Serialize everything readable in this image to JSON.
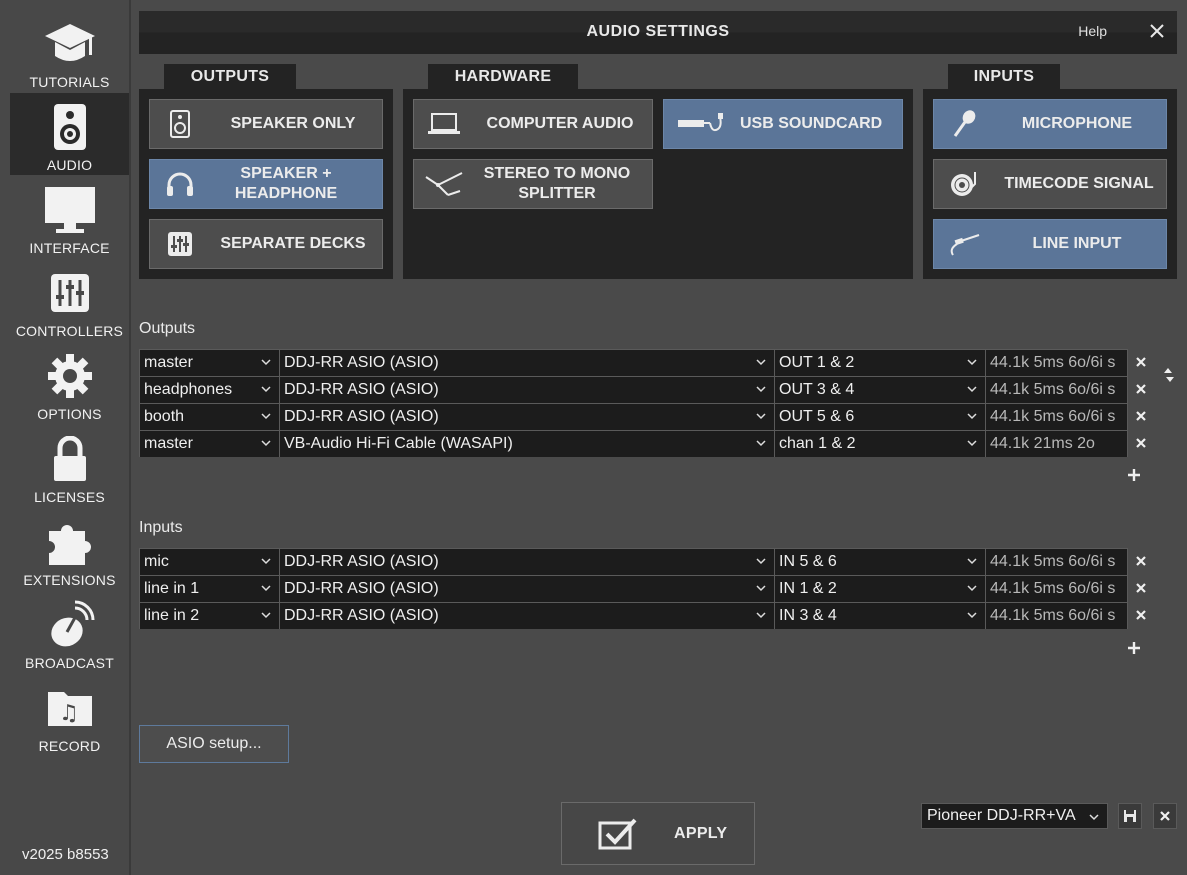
{
  "sidebar": {
    "items": [
      {
        "label": "TUTORIALS",
        "icon": "graduation-cap-icon"
      },
      {
        "label": "AUDIO",
        "icon": "speaker-icon",
        "active": true
      },
      {
        "label": "INTERFACE",
        "icon": "monitor-icon"
      },
      {
        "label": "CONTROLLERS",
        "icon": "sliders-icon"
      },
      {
        "label": "OPTIONS",
        "icon": "gear-icon"
      },
      {
        "label": "LICENSES",
        "icon": "lock-icon"
      },
      {
        "label": "EXTENSIONS",
        "icon": "puzzle-icon"
      },
      {
        "label": "BROADCAST",
        "icon": "satellite-dish-icon"
      },
      {
        "label": "RECORD",
        "icon": "music-folder-icon"
      }
    ],
    "version": "v2025 b8553"
  },
  "window": {
    "title": "AUDIO SETTINGS",
    "help": "Help"
  },
  "outputs_group": {
    "tab": "OUTPUTS",
    "buttons": [
      {
        "label": "SPEAKER ONLY",
        "active": false
      },
      {
        "label": "SPEAKER + HEADPHONE",
        "active": true
      },
      {
        "label": "SEPARATE DECKS",
        "active": false
      }
    ]
  },
  "hardware_group": {
    "tab": "HARDWARE",
    "buttons": [
      {
        "label": "COMPUTER AUDIO",
        "active": false
      },
      {
        "label": "USB SOUNDCARD",
        "active": true
      },
      {
        "label": "STEREO TO MONO SPLITTER",
        "active": false
      }
    ]
  },
  "inputs_group": {
    "tab": "INPUTS",
    "buttons": [
      {
        "label": "MICROPHONE",
        "active": true
      },
      {
        "label": "TIMECODE SIGNAL",
        "active": false
      },
      {
        "label": "LINE INPUT",
        "active": true
      }
    ]
  },
  "outputs": {
    "label": "Outputs",
    "rows": [
      {
        "role": "master",
        "device": "DDJ-RR ASIO (ASIO)",
        "channel": "OUT 1 & 2",
        "info": "44.1k 5ms 6o/6i s"
      },
      {
        "role": "headphones",
        "device": "DDJ-RR ASIO (ASIO)",
        "channel": "OUT 3 & 4",
        "info": "44.1k 5ms 6o/6i s"
      },
      {
        "role": "booth",
        "device": "DDJ-RR ASIO (ASIO)",
        "channel": "OUT 5 & 6",
        "info": "44.1k 5ms 6o/6i s"
      },
      {
        "role": "master",
        "device": "VB-Audio Hi-Fi Cable (WASAPI)",
        "channel": "chan 1 & 2",
        "info": "44.1k 21ms 2o"
      }
    ]
  },
  "inputs": {
    "label": "Inputs",
    "rows": [
      {
        "role": "mic",
        "device": "DDJ-RR ASIO (ASIO)",
        "channel": "IN 5 & 6",
        "info": "44.1k 5ms 6o/6i s"
      },
      {
        "role": "line in 1",
        "device": "DDJ-RR ASIO (ASIO)",
        "channel": "IN 1 & 2",
        "info": "44.1k 5ms 6o/6i s"
      },
      {
        "role": "line in 2",
        "device": "DDJ-RR ASIO (ASIO)",
        "channel": "IN 3 & 4",
        "info": "44.1k 5ms 6o/6i s"
      }
    ]
  },
  "footer": {
    "asio_setup": "ASIO setup...",
    "apply": "APPLY",
    "preset": "Pioneer DDJ-RR+VA"
  },
  "colors": {
    "accent": "#5b7598",
    "panel": "#232323",
    "background": "#4a4a4a"
  }
}
